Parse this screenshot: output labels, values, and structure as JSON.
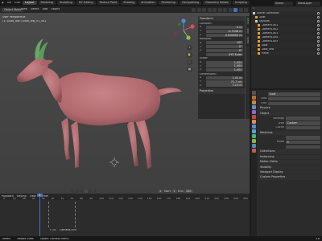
{
  "app": {
    "menus": [
      "File",
      "Edit"
    ],
    "workspace_tabs": [
      "Layout",
      "Modeling",
      "Sculpting",
      "UV Editing",
      "Texture Paint",
      "Shading",
      "Animation",
      "Rendering",
      "Compositing",
      "Geometry Nodes",
      "Scripting"
    ],
    "active_workspace": "Layout",
    "scene": "Scene",
    "view_layer": "ViewLayer"
  },
  "viewport": {
    "mode": "Object Mode",
    "menus": [
      "View",
      "Select",
      "Add",
      "Object"
    ],
    "info": [
      "User Perspective",
      "(1) Goat_low | Goat_low_v1_001"
    ],
    "nav_buttons": [
      "+",
      "✋",
      "🎥",
      "▦"
    ]
  },
  "npanel": {
    "title": "Transform",
    "location_label": "Location:",
    "location": [
      {
        "axis": "X",
        "value": "0 m"
      },
      {
        "axis": "Y",
        "value": "-0.7546 m"
      },
      {
        "axis": "Z",
        "value": "0.000000 m"
      }
    ],
    "rotation_label": "Rotation:",
    "rotation": [
      {
        "axis": "X",
        "value": "90°"
      },
      {
        "axis": "Y",
        "value": "0°"
      },
      {
        "axis": "Z",
        "value": "0°"
      }
    ],
    "mode_label": "XYZ Euler",
    "scale_label": "Scale:",
    "scale": [
      {
        "axis": "X",
        "value": "1.000"
      },
      {
        "axis": "Y",
        "value": "1.000"
      },
      {
        "axis": "Z",
        "value": "1.000"
      }
    ],
    "dimensions_label": "Dimensions:",
    "dimensions": [
      {
        "axis": "X",
        "value": "1.41 m"
      },
      {
        "axis": "Y",
        "value": "71.7 cm"
      },
      {
        "axis": "Z",
        "value": "1.14 m"
      }
    ],
    "properties_label": "Properties",
    "tabs": [
      "Item",
      "Tool",
      "View"
    ]
  },
  "outliner": {
    "title": "Scene Collection",
    "items": [
      {
        "label": "Scene Collection",
        "color": "#d0d0d0"
      },
      {
        "label": "Goat",
        "color": "#e6a13b"
      },
      {
        "label": "Layouts",
        "color": "#d0d0d0"
      },
      {
        "label": "Camera.001",
        "color": "#e6a13b"
      },
      {
        "label": "Camera.002",
        "color": "#e6a13b"
      },
      {
        "label": "Camera.003",
        "color": "#e6a13b"
      },
      {
        "label": "Camera.004",
        "color": "#e6a13b"
      },
      {
        "label": "Camera.005",
        "color": "#e6a13b"
      },
      {
        "label": "Goat",
        "color": "#e6a13b"
      },
      {
        "label": "Goat_low",
        "color": "#e6a13b"
      },
      {
        "label": "Plane",
        "color": "#e6a13b"
      }
    ]
  },
  "properties": {
    "object_name": "Goat",
    "rows": [
      {
        "label": "",
        "value": "Goat"
      },
      {
        "label": "Add",
        "value": ""
      },
      {
        "label": "Edit",
        "value": ""
      }
    ],
    "sections": [
      {
        "title": "Physics",
        "rows": []
      },
      {
        "title": "Object",
        "rows": [
          {
            "label": "Settings",
            "value": ""
          },
          {
            "label": "Type",
            "value": "Custom"
          },
          {
            "label": "Cache",
            "value": ""
          }
        ]
      },
      {
        "title": "Relations",
        "rows": [
          {
            "label": "",
            "value": ""
          },
          {
            "label": "Mode",
            "value": "X"
          },
          {
            "label": "",
            "value": ""
          }
        ]
      },
      {
        "title": "Collections",
        "rows": []
      },
      {
        "title": "Instancing",
        "rows": []
      },
      {
        "title": "Motion Paths",
        "rows": []
      },
      {
        "title": "Visibility",
        "rows": []
      },
      {
        "title": "Viewport Display",
        "rows": []
      },
      {
        "title": "Custom Properties",
        "rows": []
      }
    ]
  },
  "timeline": {
    "menus": [
      "Playback",
      "Keying",
      "View",
      "Marker"
    ],
    "current_frame": "1",
    "frame_numbers": [
      "0",
      "10",
      "20",
      "30",
      "40",
      "50",
      "60",
      "70",
      "80",
      "90",
      "100",
      "110",
      "120",
      "130",
      "140",
      "150",
      "160",
      "170",
      "180",
      "190",
      "200",
      "210",
      "220",
      "230",
      "240",
      "250"
    ],
    "start_label": "Start",
    "start": "1",
    "end_label": "End",
    "end": "250",
    "markers": [
      "F_01",
      "Camera.005"
    ]
  },
  "statusbar": {
    "items": [
      "Select",
      "Rotate View",
      "Object Context Menu"
    ],
    "version": "3.6"
  },
  "colors": {
    "accent": "#4772b3",
    "goat_body": "#b06a6e",
    "horns": "#6aa667"
  }
}
